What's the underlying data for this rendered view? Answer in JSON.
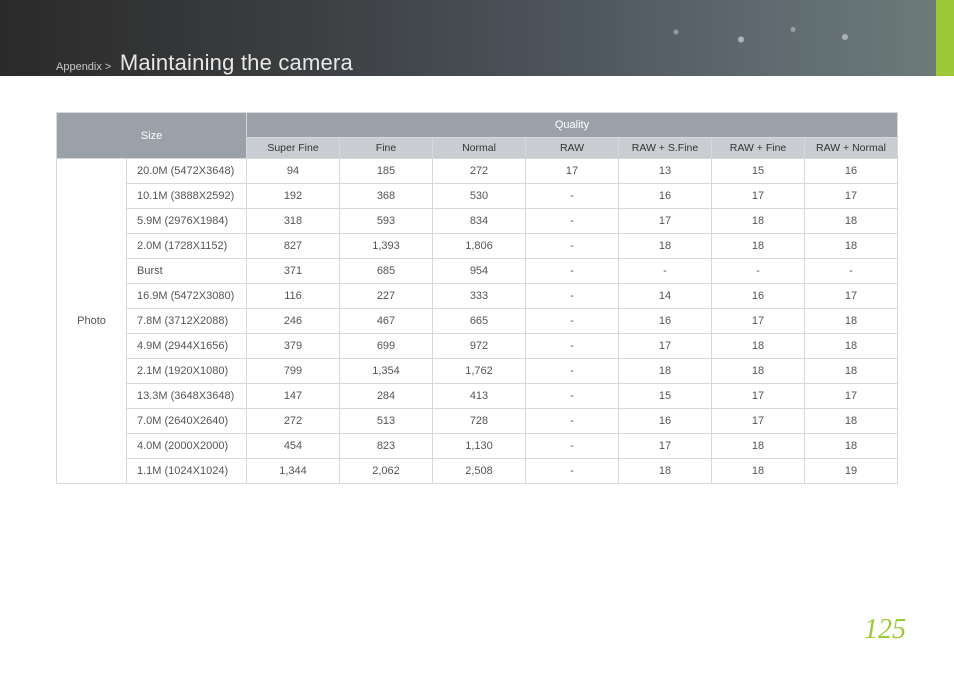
{
  "breadcrumb": {
    "section": "Appendix >",
    "title": "Maintaining the camera"
  },
  "page_number": "125",
  "table": {
    "size_header": "Size",
    "quality_header": "Quality",
    "quality_columns": [
      "Super Fine",
      "Fine",
      "Normal",
      "RAW",
      "RAW + S.Fine",
      "RAW + Fine",
      "RAW + Normal"
    ],
    "group_label": "Photo",
    "rows": [
      {
        "size": "20.0M (5472X3648)",
        "vals": [
          "94",
          "185",
          "272",
          "17",
          "13",
          "15",
          "16"
        ]
      },
      {
        "size": "10.1M (3888X2592)",
        "vals": [
          "192",
          "368",
          "530",
          "-",
          "16",
          "17",
          "17"
        ]
      },
      {
        "size": "5.9M (2976X1984)",
        "vals": [
          "318",
          "593",
          "834",
          "-",
          "17",
          "18",
          "18"
        ]
      },
      {
        "size": "2.0M (1728X1152)",
        "vals": [
          "827",
          "1,393",
          "1,806",
          "-",
          "18",
          "18",
          "18"
        ]
      },
      {
        "size": "Burst",
        "vals": [
          "371",
          "685",
          "954",
          "-",
          "-",
          "-",
          "-"
        ]
      },
      {
        "size": "16.9M (5472X3080)",
        "vals": [
          "116",
          "227",
          "333",
          "-",
          "14",
          "16",
          "17"
        ]
      },
      {
        "size": "7.8M (3712X2088)",
        "vals": [
          "246",
          "467",
          "665",
          "-",
          "16",
          "17",
          "18"
        ]
      },
      {
        "size": "4.9M (2944X1656)",
        "vals": [
          "379",
          "699",
          "972",
          "-",
          "17",
          "18",
          "18"
        ]
      },
      {
        "size": "2.1M (1920X1080)",
        "vals": [
          "799",
          "1,354",
          "1,762",
          "-",
          "18",
          "18",
          "18"
        ]
      },
      {
        "size": "13.3M (3648X3648)",
        "vals": [
          "147",
          "284",
          "413",
          "-",
          "15",
          "17",
          "17"
        ]
      },
      {
        "size": "7.0M (2640X2640)",
        "vals": [
          "272",
          "513",
          "728",
          "-",
          "16",
          "17",
          "18"
        ]
      },
      {
        "size": "4.0M (2000X2000)",
        "vals": [
          "454",
          "823",
          "1,130",
          "-",
          "17",
          "18",
          "18"
        ]
      },
      {
        "size": "1.1M (1024X1024)",
        "vals": [
          "1,344",
          "2,062",
          "2,508",
          "-",
          "18",
          "18",
          "19"
        ]
      }
    ]
  }
}
